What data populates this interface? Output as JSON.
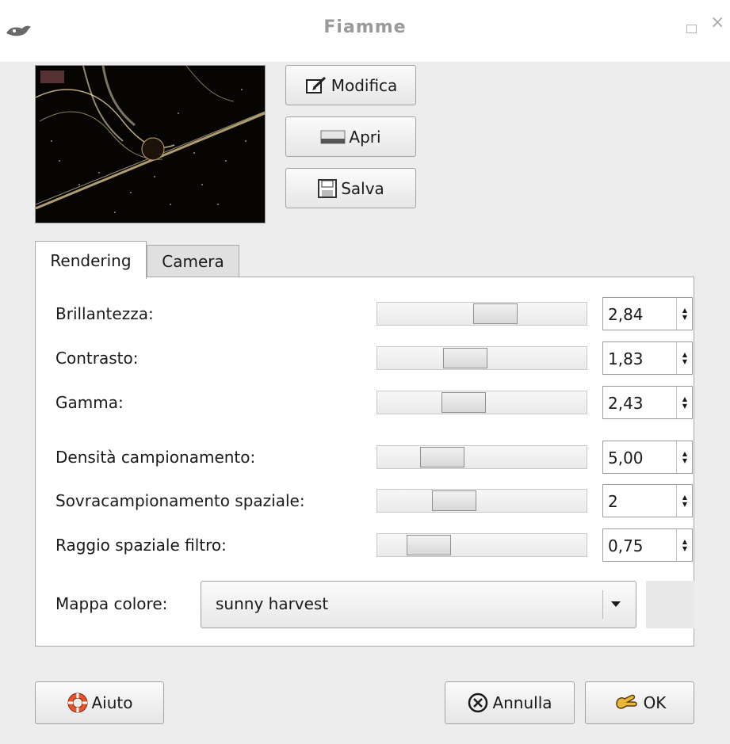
{
  "window": {
    "title": "Fiamme",
    "maximize_glyph": "□",
    "close_glyph": "×"
  },
  "top_buttons": {
    "edit": "Modifica",
    "open": "Apri",
    "save": "Salva"
  },
  "tabs": [
    {
      "label": "Rendering",
      "active": true
    },
    {
      "label": "Camera",
      "active": false
    }
  ],
  "rendering": {
    "rows": [
      {
        "label": "Brillantezza:",
        "value": "2,84",
        "slider_fraction": 0.58
      },
      {
        "label": "Contrasto:",
        "value": "1,83",
        "slider_fraction": 0.4
      },
      {
        "label": "Gamma:",
        "value": "2,43",
        "slider_fraction": 0.39
      },
      {
        "label": "Densità campionamento:",
        "value": "5,00",
        "slider_fraction": 0.26
      },
      {
        "label": "Sovracampionamento spaziale:",
        "value": "2",
        "slider_fraction": 0.33
      },
      {
        "label": "Raggio spaziale filtro:",
        "value": "0,75",
        "slider_fraction": 0.18
      }
    ],
    "colormap": {
      "label": "Mappa colore:",
      "value": "sunny harvest"
    }
  },
  "bottom_buttons": {
    "help": "Aiuto",
    "cancel": "Annulla",
    "ok": "OK"
  },
  "icons": {
    "app": "gimp-wilber-icon",
    "edit": "edit-icon",
    "open": "open-icon",
    "save": "floppy-icon",
    "help": "lifebuoy-icon",
    "cancel": "cancel-circle-icon",
    "ok": "ok-hand-icon"
  }
}
